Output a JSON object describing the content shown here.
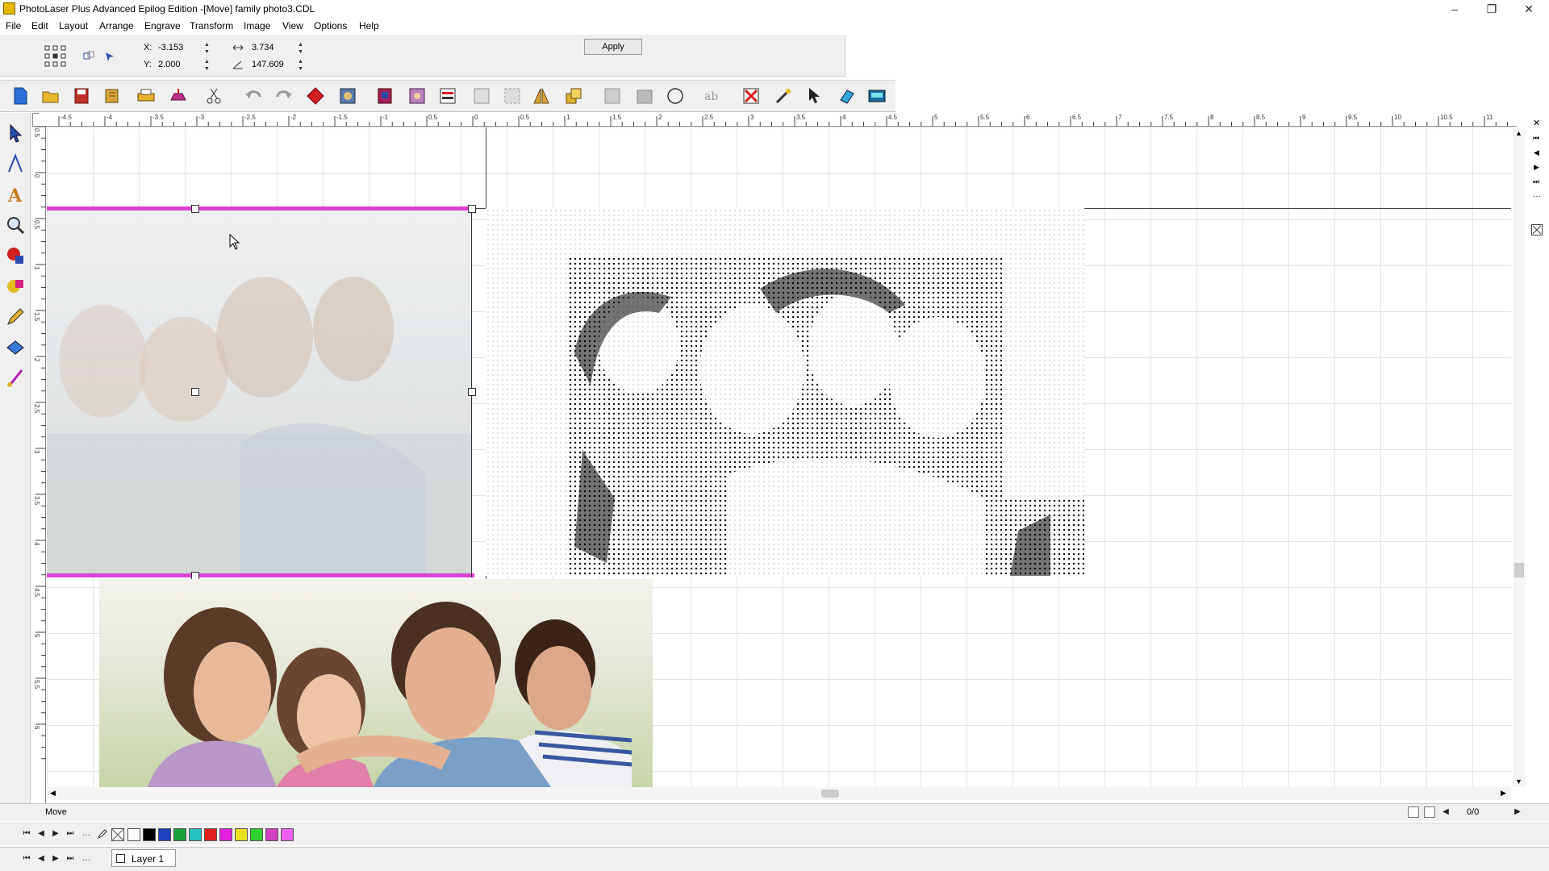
{
  "window": {
    "title": "PhotoLaser Plus Advanced Epilog Edition -[Move] family photo3.CDL",
    "minimize": "–",
    "restore": "❐",
    "close": "✕"
  },
  "menu": [
    "File",
    "Edit",
    "Layout",
    "Arrange",
    "Engrave",
    "Transform",
    "Image",
    "View",
    "Options",
    "Help"
  ],
  "props": {
    "x_label": "X:",
    "x_value": "-3.153",
    "y_label": "Y:",
    "y_value": "2.000",
    "width_value": "3.734",
    "angle_value": "147.609",
    "apply_label": "Apply"
  },
  "hruler_ticks": [
    "-4.5",
    "-4",
    "-3.5",
    "-3",
    "-2.5",
    "-2",
    "-1.5",
    "-1",
    "0.5",
    "0",
    "0.5",
    "1",
    "1.5",
    "2",
    "2.5",
    "3",
    "3.5",
    "4",
    "4.5",
    "5",
    "5.5",
    "6",
    "6.5",
    "7",
    "7.5",
    "8",
    "8.5",
    "9",
    "9.5",
    "10",
    "10.5",
    "11"
  ],
  "vruler_ticks": [
    "0.5",
    "0",
    "0.5",
    "1",
    "1.5",
    "2",
    "2.5",
    "3",
    "3.5",
    "4",
    "4.5",
    "5",
    "5.5",
    "6"
  ],
  "status": {
    "mode": "Move",
    "page_counter": "0/0"
  },
  "layer": {
    "name": "Layer 1"
  },
  "colors": {
    "selection": "#e040d0",
    "grid": "#e4e4e4",
    "chrome": "#f0f0f0"
  },
  "palette": [
    "#ffffff",
    "#000000",
    "#1f3fbf",
    "#19a23a",
    "#28c0c0",
    "#e02020",
    "#e020e0",
    "#e8e020",
    "#30d030",
    "#d040c0",
    "#f060f0"
  ]
}
